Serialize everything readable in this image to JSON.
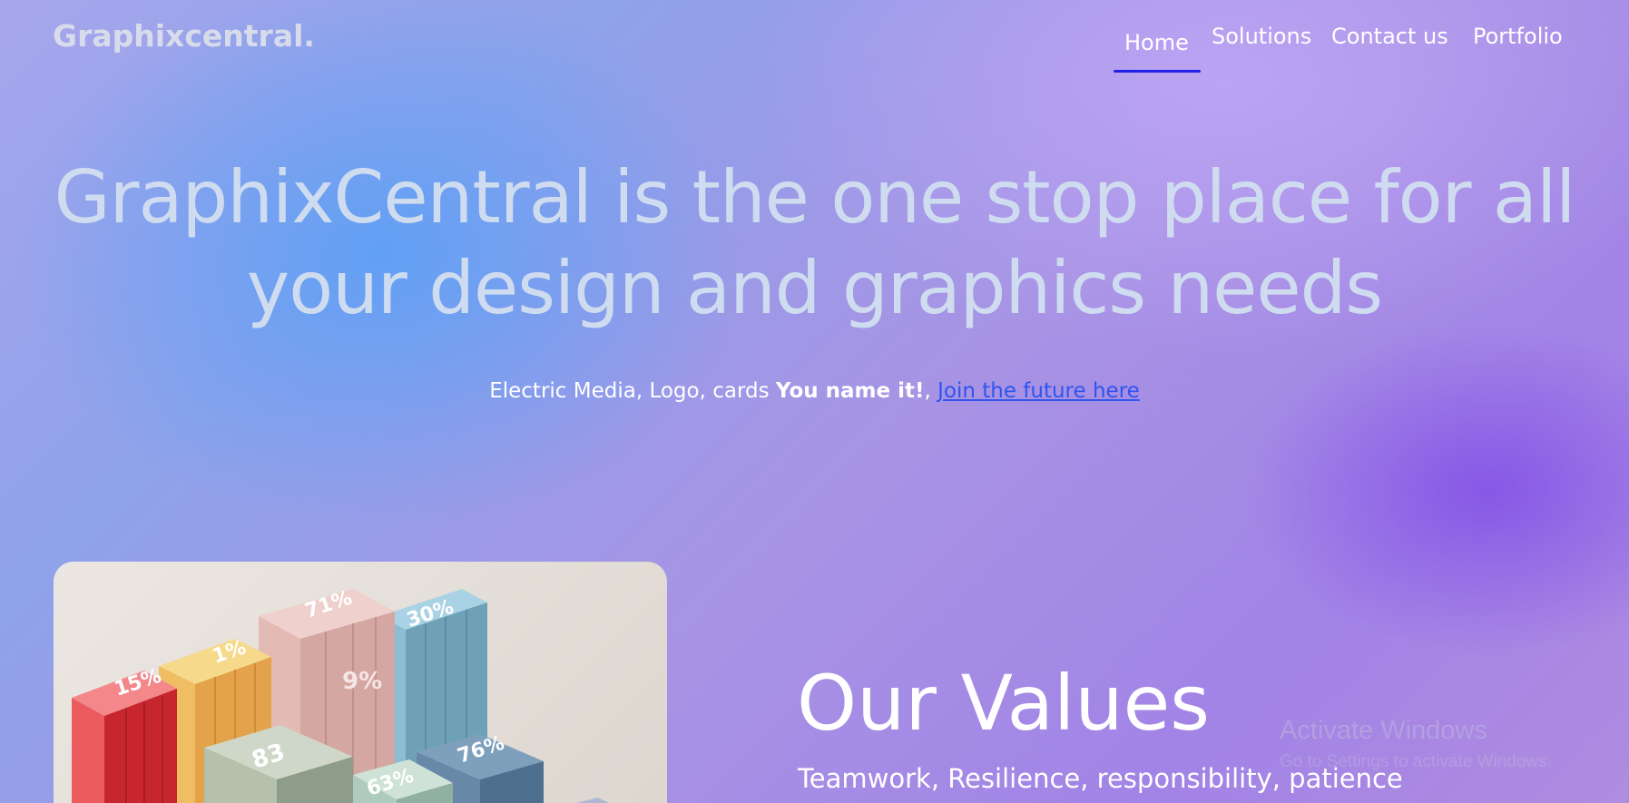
{
  "header": {
    "logo": "Graphixcentral.",
    "nav": [
      {
        "label": "Home",
        "active": true
      },
      {
        "label": "Solutions"
      },
      {
        "label": "Contact us"
      },
      {
        "label": "Portfolio"
      }
    ]
  },
  "hero": {
    "title_line1": "GraphixCentral is the one stop place for all",
    "title_line2": "your design and graphics needs",
    "subtitle_prefix": "Electric Media, Logo, cards ",
    "subtitle_bold": "You name it!",
    "subtitle_sep": ", ",
    "link_text": "Join the future here"
  },
  "image_card": {
    "labels": [
      "15%",
      "1%",
      "71%",
      "9%",
      "30%",
      "83",
      "63%",
      "76%"
    ]
  },
  "values": {
    "title": "Our Values",
    "text": "Teamwork, Resilience, responsibility, patience"
  },
  "watermark": {
    "title": "Activate Windows",
    "subtitle": "Go to Settings to activate Windows."
  },
  "colors": {
    "nav_underline": "#2121e8",
    "link": "#2f55ee",
    "hero_text": "#cfdcf0"
  }
}
